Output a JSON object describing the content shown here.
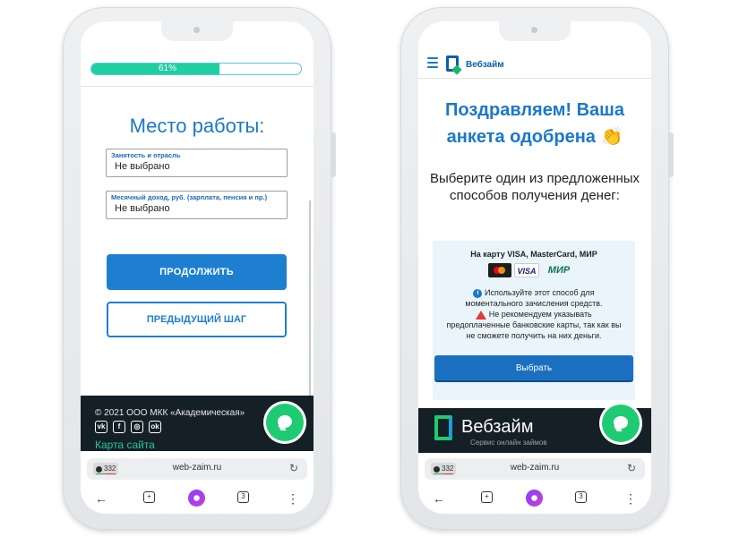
{
  "left_phone": {
    "progress_label": "61%",
    "progress_value": 0.61,
    "title": "Место работы:",
    "fields": [
      {
        "label": "Занятость и отрасль",
        "value": "Не выбрано"
      },
      {
        "label": "Месячный доход, руб. (зарплата, пенсия и пр.)",
        "value": "Не выбрано"
      }
    ],
    "continue_label": "ПРОДОЛЖИТЬ",
    "previous_label": "ПРЕДЫДУЩИЙ ШАГ",
    "footer": {
      "copyright": "© 2021 ООО МКК «Академическая»",
      "social_icons": [
        "vk-icon",
        "facebook-icon",
        "instagram-icon",
        "odnoklassniki-icon"
      ],
      "sitemap": "Карта сайта"
    },
    "browser": {
      "badge": "332",
      "url": "web-zaim.ru",
      "tabs_count": "3"
    }
  },
  "right_phone": {
    "brand": "Вебзайм",
    "congrats": "Поздравляем! Ваша анкета одобрена 👏",
    "choose": "Выберите один из предложенных способов получения денег:",
    "panel": {
      "title": "На карту VISA, MasterCard, МИР",
      "cards": [
        "MasterCard",
        "VISA",
        "МИР"
      ],
      "info": "Используйте этот способ для моментального зачисления средств.",
      "warning": "Не рекомендуем указывать предоплаченные банковские карты, так как вы не сможете получить на них деньги.",
      "button": "Выбрать"
    },
    "footer_brand": "Вебзайм",
    "footer_sub": "Сервис онлайн займов",
    "browser": {
      "badge": "332",
      "url": "web-zaim.ru",
      "tabs_count": "3"
    }
  },
  "colors": {
    "accent": "#1e7fd1",
    "progress": "#1fcfa0",
    "chat": "#1fcb72",
    "footer_bg": "#151f26"
  }
}
